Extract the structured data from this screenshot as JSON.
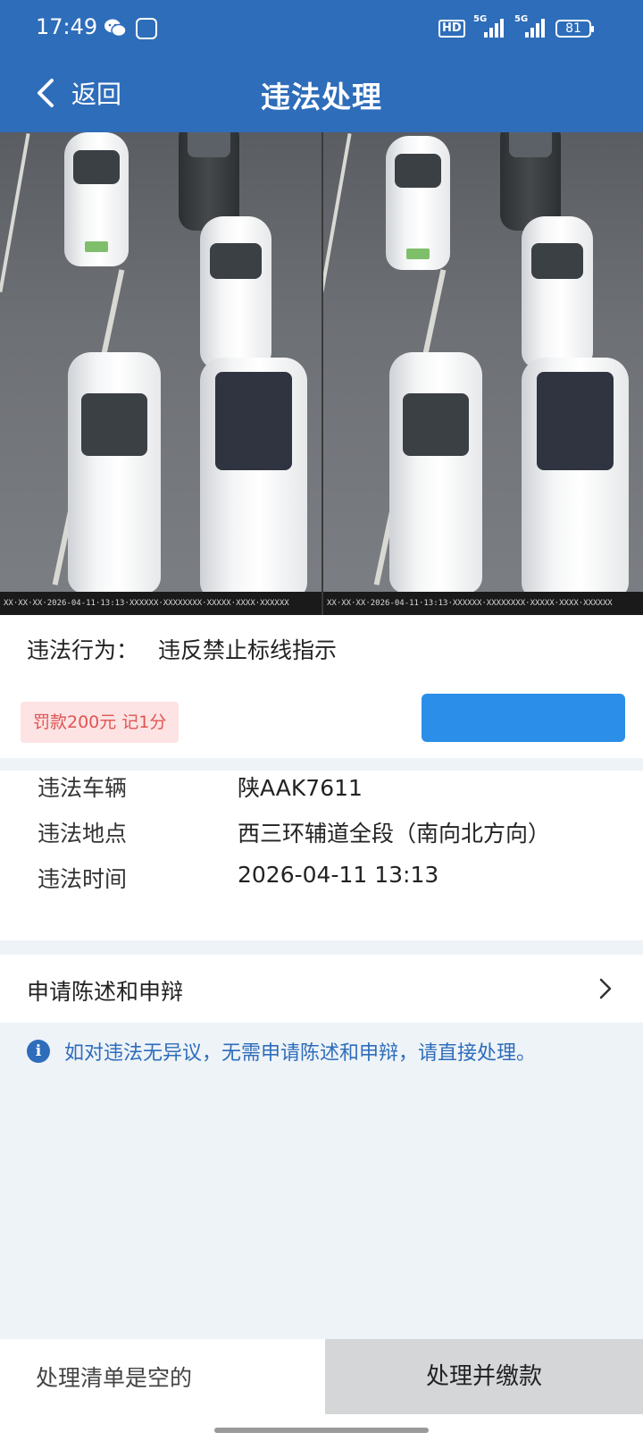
{
  "status_bar": {
    "time": "17:49",
    "icons": [
      "wechat-icon",
      "app-icon",
      "hd-icon",
      "signal-5g-icon",
      "signal-5g-icon",
      "battery-icon"
    ],
    "hd_label": "HD",
    "network1": "5G",
    "network2": "5G",
    "battery": "81"
  },
  "header": {
    "back_label": "返回",
    "title": "违法处理",
    "background": "#2e6dba"
  },
  "photos": {
    "caption": "XX·XX·XX·2026-04-11·13:13·XXXXXX·XXXXXXXX·XXXXX·XXXX·XXXXXX"
  },
  "violation": {
    "label": "违法行为：",
    "value": "违反禁止标线指示",
    "fine_badge": "罚款200元 记1分"
  },
  "details": [
    {
      "key": "违法车辆",
      "value": "陕AAK7611"
    },
    {
      "key": "违法地点",
      "value": "西三环辅道全段（南向北方向）"
    },
    {
      "key": "违法时间",
      "value": "2026-04-11 13:13"
    }
  ],
  "appeal": {
    "label": "申请陈述和申辩"
  },
  "info": {
    "icon": "i",
    "text": "如对违法无异议，无需申请陈述和申辩，请直接处理。"
  },
  "bottom": {
    "empty_label": "处理清单是空的",
    "submit_label": "处理并缴款"
  },
  "colors": {
    "accent": "#2e6dba",
    "fine_bg": "#fde3e3",
    "fine_text": "#e05454",
    "action_blue": "#2b8ee8"
  }
}
